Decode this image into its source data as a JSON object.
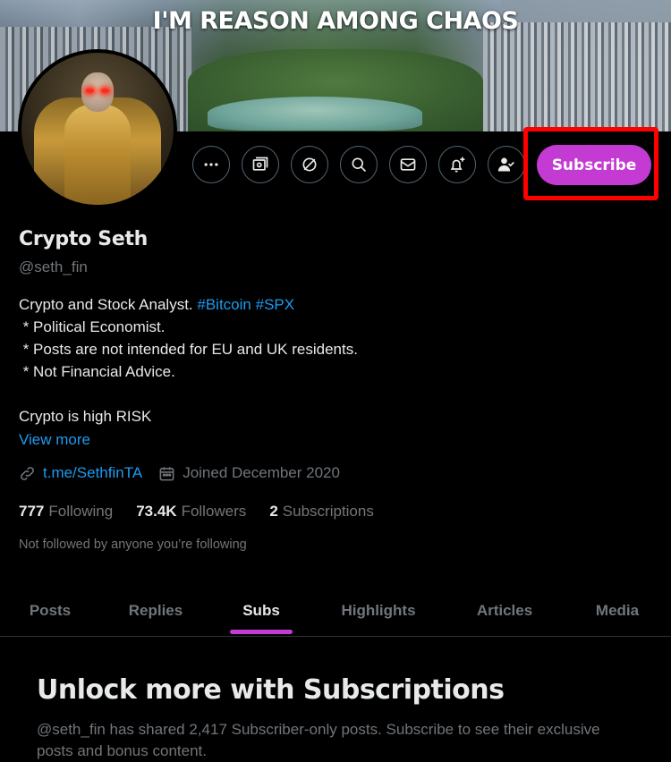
{
  "banner": {
    "title": "I'M REASON AMONG CHAOS"
  },
  "actions": [
    {
      "icon": "more-icon",
      "label": "More"
    },
    {
      "icon": "grok-icon",
      "label": "Grok"
    },
    {
      "icon": "no-ads-icon",
      "label": "Block ads"
    },
    {
      "icon": "search-icon",
      "label": "Search"
    },
    {
      "icon": "message-icon",
      "label": "Message"
    },
    {
      "icon": "notification-add-icon",
      "label": "Turn on notifications"
    },
    {
      "icon": "following-icon",
      "label": "Following"
    }
  ],
  "subscribe_label": "Subscribe",
  "profile": {
    "name": "Crypto Seth",
    "handle": "@seth_fin",
    "bio": {
      "line1_text": "Crypto and Stock Analyst. ",
      "tag1": "#Bitcoin",
      "tag2": "#SPX",
      "line2": " * Political Economist.",
      "line3": " * Posts are not intended for EU and UK residents.",
      "line4": " * Not Financial Advice.",
      "line6": "Crypto is high RISK"
    },
    "view_more": "View more",
    "link": "t.me/SethfinTA",
    "joined": "Joined December 2020",
    "stats": {
      "following_count": "777",
      "following_label": "Following",
      "followers_count": "73.4K",
      "followers_label": "Followers",
      "subscriptions_count": "2",
      "subscriptions_label": "Subscriptions"
    },
    "not_followed": "Not followed by anyone you’re following"
  },
  "tabs": [
    "Posts",
    "Replies",
    "Subs",
    "Highlights",
    "Articles",
    "Media"
  ],
  "active_tab": "Subs",
  "subscriptions": {
    "title": "Unlock more with Subscriptions",
    "description": "@seth_fin has shared 2,417 Subscriber-only posts. Subscribe to see their exclusive posts and bonus content."
  },
  "colors": {
    "accent": "#c43bd3",
    "link": "#1d9bf0",
    "highlight": "#ff0000"
  }
}
